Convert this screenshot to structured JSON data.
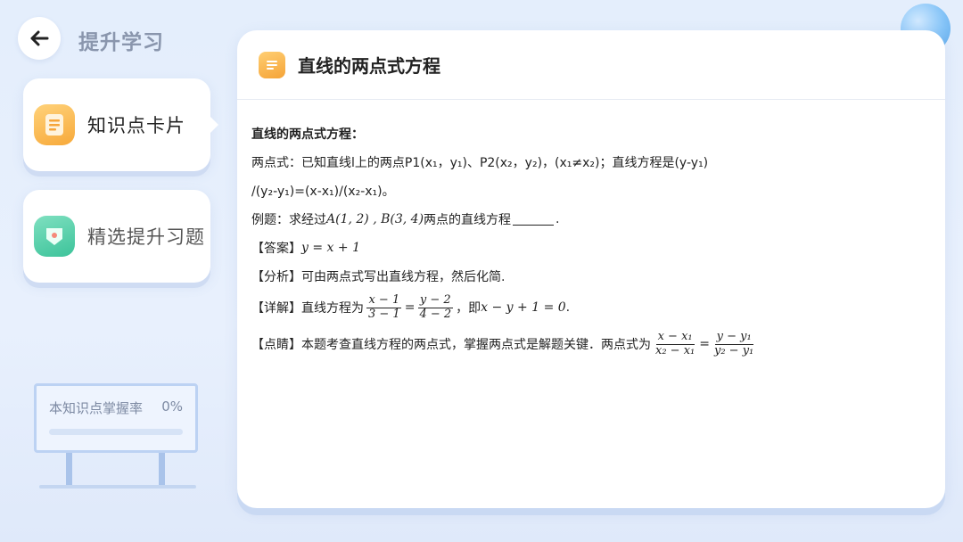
{
  "header": {
    "back_label": "back",
    "title": "提升学习"
  },
  "sidebar": {
    "items": [
      {
        "label": "知识点卡片",
        "icon": "notebook-icon",
        "active": true
      },
      {
        "label": "精选提升习题",
        "icon": "shield-star-icon",
        "active": false
      }
    ]
  },
  "mastery": {
    "label": "本知识点掌握率",
    "value": "0%",
    "fraction": 0
  },
  "content": {
    "title": "直线的两点式方程",
    "heading": "直线的两点式方程：",
    "formula_line1": "两点式：已知直线l上的两点P1(x₁，y₁)、P2(x₂，y₂)，(x₁≠x₂)；直线方程是(y-y₁)",
    "formula_line2": "/(y₂-y₁)=(x-x₁)/(x₂-x₁)。",
    "example_prefix": "例题：求经过",
    "example_points": "A(1, 2) , B(3, 4)",
    "example_suffix": "两点的直线方程",
    "answer_label": "【答案】",
    "answer_math": "y = x + 1",
    "analysis": "【分析】可由两点式写出直线方程，然后化简.",
    "detail_label": "【详解】直线方程为",
    "detail_frac1_num": "x − 1",
    "detail_frac1_den": "3 − 1",
    "detail_frac2_num": "y − 2",
    "detail_frac2_den": "4 − 2",
    "detail_mid": "，即",
    "detail_result": "x − y + 1 = 0",
    "point_label": "【点睛】本题考查直线方程的两点式，掌握两点式是解题关键．两点式为",
    "point_frac1_num": "x − x₁",
    "point_frac1_den": "x₂ − x₁",
    "point_frac2_num": "y − y₁",
    "point_frac2_den": "y₂ − y₁"
  },
  "colors": {
    "accent": "#5b9af0",
    "card_icon_orange": "#f7a93a",
    "card_icon_green": "#3cc39a"
  }
}
